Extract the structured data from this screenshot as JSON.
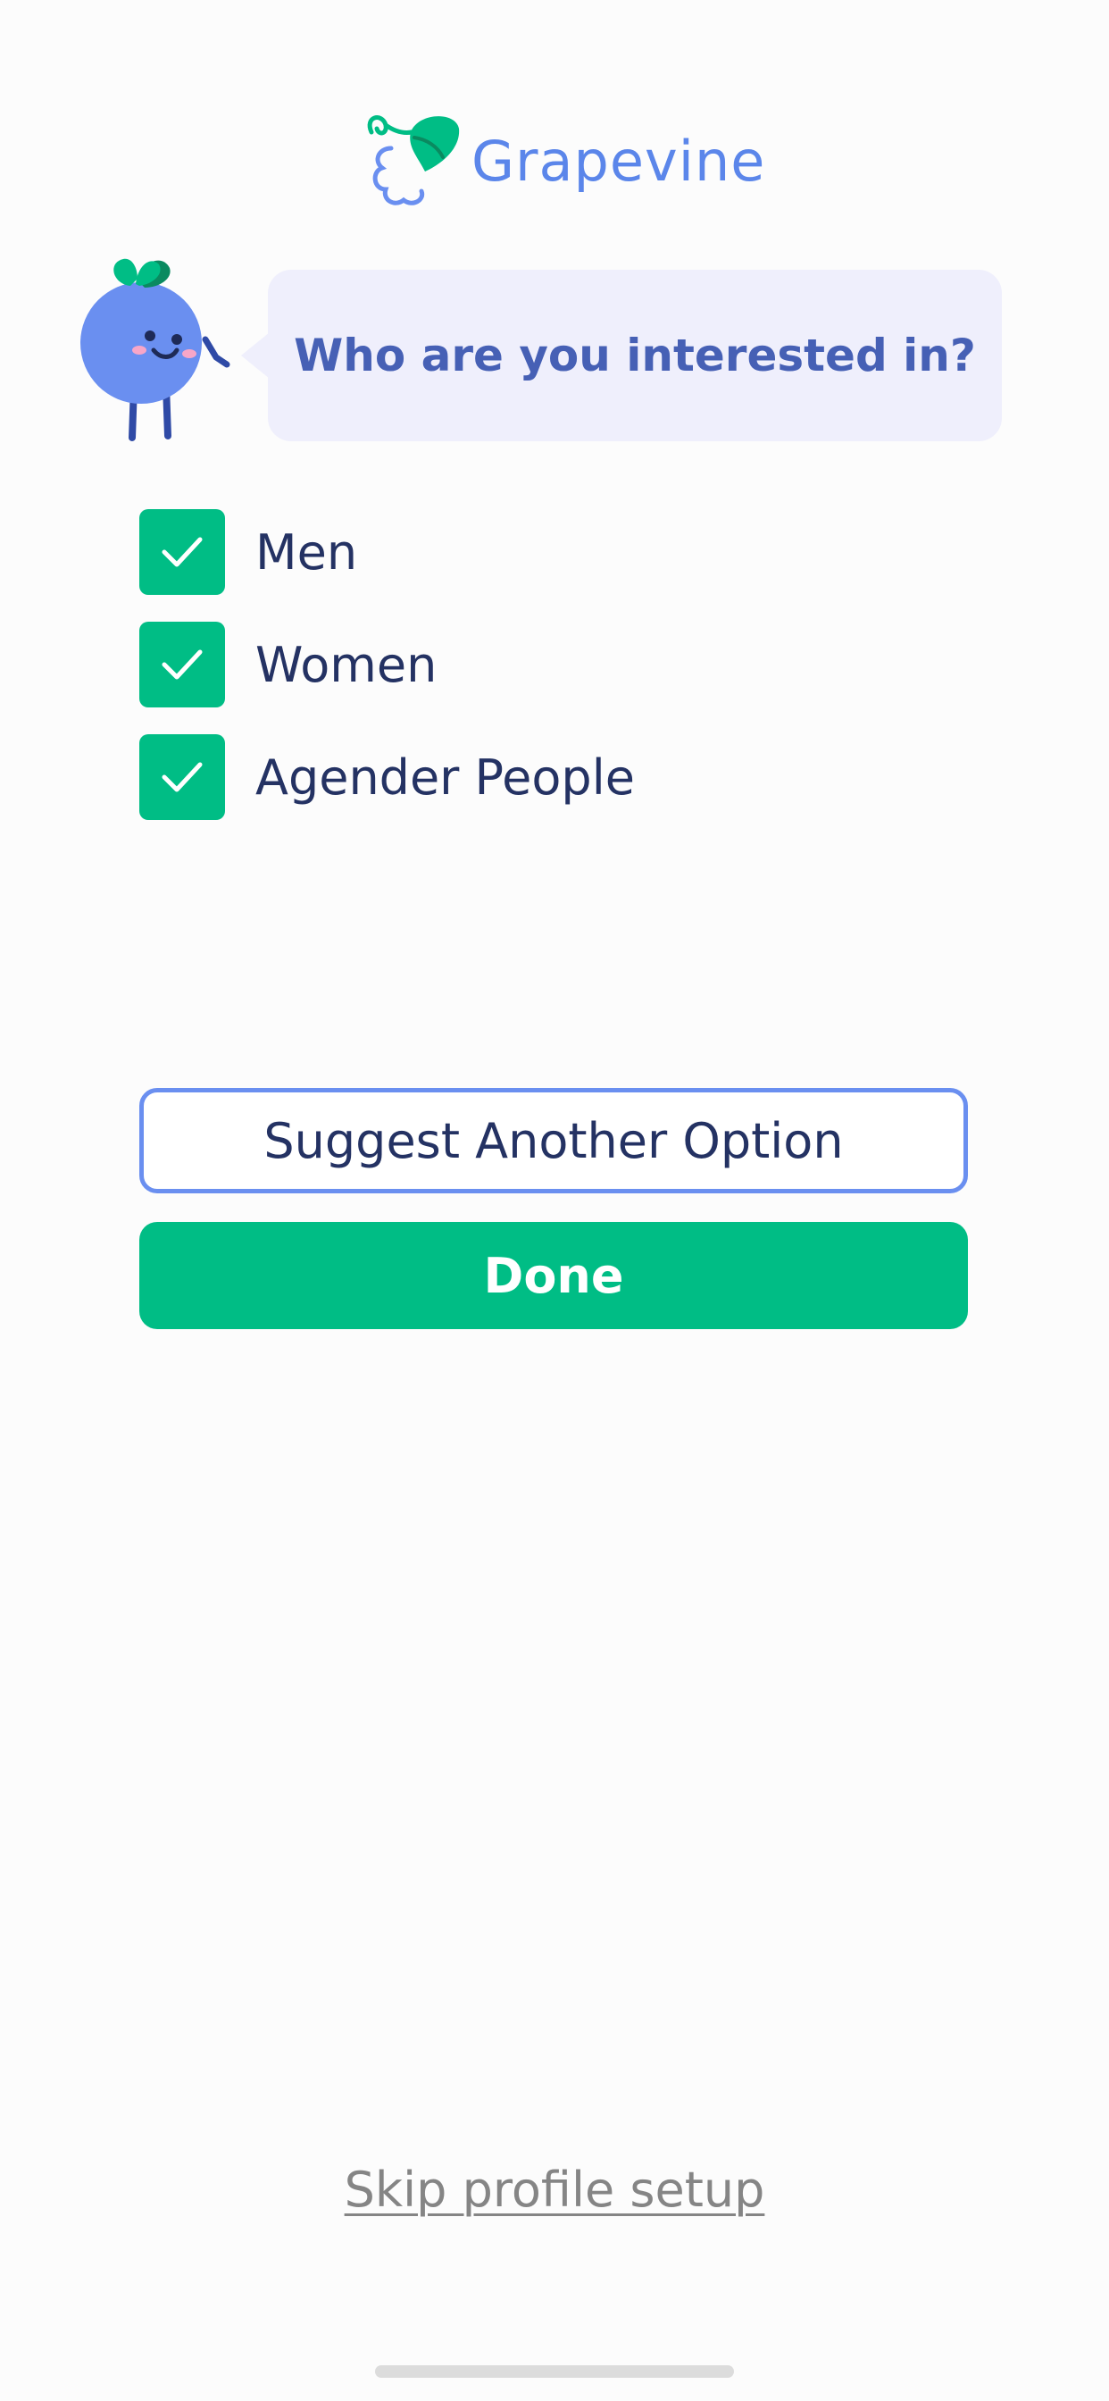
{
  "app": {
    "logo_text": "Grapevine"
  },
  "prompt": {
    "question": "Who are you interested in?"
  },
  "options": [
    {
      "label": "Men",
      "checked": true
    },
    {
      "label": "Women",
      "checked": true
    },
    {
      "label": "Agender People",
      "checked": true
    }
  ],
  "actions": {
    "suggest_label": "Suggest Another Option",
    "done_label": "Done",
    "skip_label": "Skip profile setup"
  },
  "colors": {
    "accent_green": "#00bd85",
    "brand_blue": "#5b86ea",
    "heading_blue": "#4660b5",
    "text_dark": "#243263",
    "bubble_bg": "#efeffc"
  },
  "icons": {
    "logo": "grape-leaf-icon",
    "mascot": "blueberry-mascot-icon",
    "checkbox": "checkmark-icon"
  }
}
